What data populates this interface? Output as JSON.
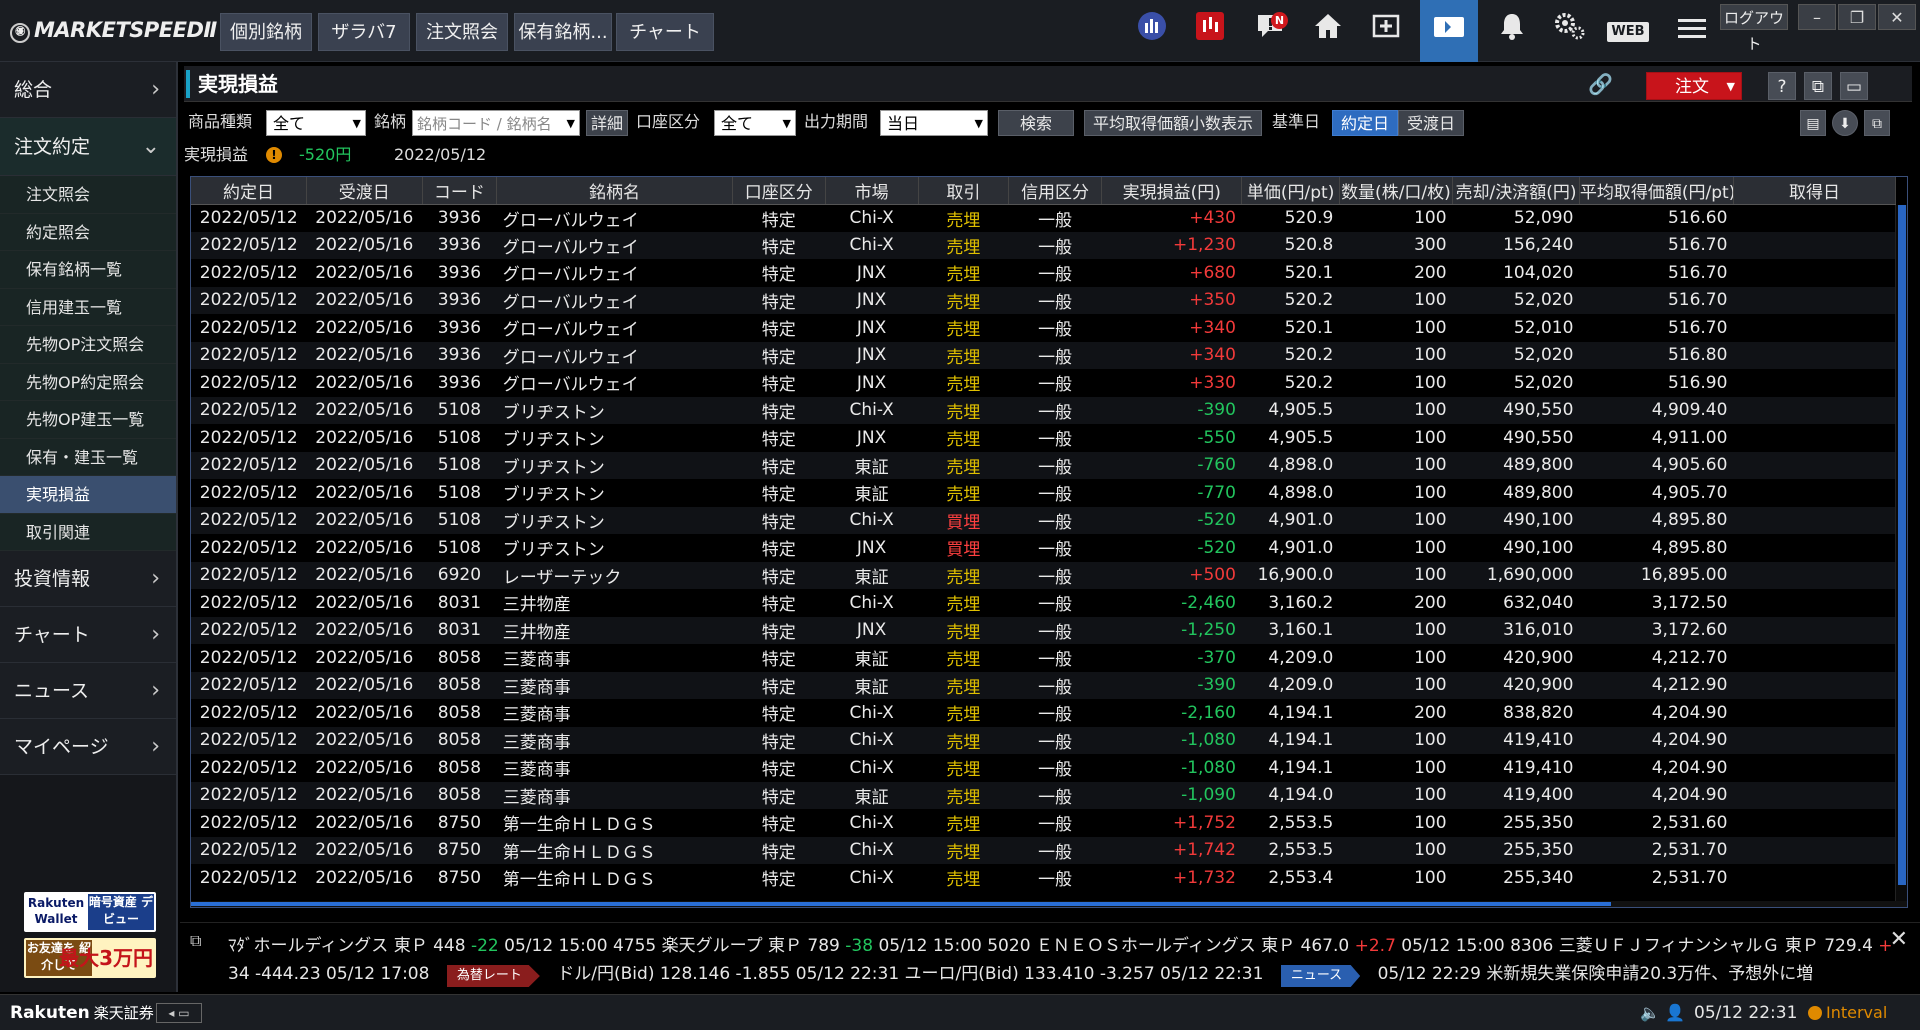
{
  "app": {
    "logo": "MARKETSPEEDⅡ",
    "top_tabs": [
      "個別銘柄",
      "ザラバ7",
      "注文照会",
      "保有銘柄...",
      "チャート"
    ],
    "notification_badge": "N",
    "web_label": "WEB",
    "logout_label": "ログアウト"
  },
  "sidebar": {
    "majors": [
      {
        "label": "総合"
      },
      {
        "label": "注文約定"
      },
      {
        "label": "投資情報"
      },
      {
        "label": "チャート"
      },
      {
        "label": "ニュース"
      },
      {
        "label": "マイページ"
      }
    ],
    "sub_items": [
      "注文照会",
      "約定照会",
      "保有銘柄一覧",
      "信用建玉一覧",
      "先物OP注文照会",
      "先物OP約定照会",
      "先物OP建玉一覧",
      "保有・建玉一覧",
      "実現損益",
      "取引関連"
    ],
    "active_sub": "実現損益",
    "promo1": {
      "left": "Rakuten Wallet",
      "right": "暗号資産 デビュー"
    },
    "promo2": {
      "left": "お友達を 紹介して",
      "right": "最大3万円"
    }
  },
  "panel": {
    "title": "実現損益",
    "order_button": "注文",
    "help_icon": "?"
  },
  "filters": {
    "product_type_label": "商品種類",
    "product_type_value": "全て",
    "symbol_label": "銘柄",
    "symbol_placeholder": "銘柄コード / 銘柄名",
    "detail_button": "詳細",
    "account_label": "口座区分",
    "account_value": "全て",
    "period_label": "出力期間",
    "period_value": "当日",
    "search_button": "検索",
    "avg_price_button": "平均取得価額小数表示",
    "base_date_label": "基準日",
    "trade_date_button": "約定日",
    "settle_date_button": "受渡日"
  },
  "summary": {
    "label": "実現損益",
    "value": "-520円",
    "date": "2022/05/12"
  },
  "table": {
    "columns": [
      "約定日",
      "受渡日",
      "コード",
      "銘柄名",
      "口座区分",
      "市場",
      "取引",
      "信用区分",
      "実現損益(円)",
      "単価(円/pt)",
      "数量(株/口/枚)",
      "売却/決済額(円)",
      "平均取得価額(円/pt)",
      "取得日"
    ],
    "rows": [
      [
        "2022/05/12",
        "2022/05/16",
        "3936",
        "グローバルウェイ",
        "特定",
        "Chi-X",
        "売埋",
        "一般",
        "+430",
        "520.9",
        "100",
        "52,090",
        "516.60"
      ],
      [
        "2022/05/12",
        "2022/05/16",
        "3936",
        "グローバルウェイ",
        "特定",
        "Chi-X",
        "売埋",
        "一般",
        "+1,230",
        "520.8",
        "300",
        "156,240",
        "516.70"
      ],
      [
        "2022/05/12",
        "2022/05/16",
        "3936",
        "グローバルウェイ",
        "特定",
        "JNX",
        "売埋",
        "一般",
        "+680",
        "520.1",
        "200",
        "104,020",
        "516.70"
      ],
      [
        "2022/05/12",
        "2022/05/16",
        "3936",
        "グローバルウェイ",
        "特定",
        "JNX",
        "売埋",
        "一般",
        "+350",
        "520.2",
        "100",
        "52,020",
        "516.70"
      ],
      [
        "2022/05/12",
        "2022/05/16",
        "3936",
        "グローバルウェイ",
        "特定",
        "JNX",
        "売埋",
        "一般",
        "+340",
        "520.1",
        "100",
        "52,010",
        "516.70"
      ],
      [
        "2022/05/12",
        "2022/05/16",
        "3936",
        "グローバルウェイ",
        "特定",
        "JNX",
        "売埋",
        "一般",
        "+340",
        "520.2",
        "100",
        "52,020",
        "516.80"
      ],
      [
        "2022/05/12",
        "2022/05/16",
        "3936",
        "グローバルウェイ",
        "特定",
        "JNX",
        "売埋",
        "一般",
        "+330",
        "520.2",
        "100",
        "52,020",
        "516.90"
      ],
      [
        "2022/05/12",
        "2022/05/16",
        "5108",
        "ブリヂストン",
        "特定",
        "Chi-X",
        "売埋",
        "一般",
        "-390",
        "4,905.5",
        "100",
        "490,550",
        "4,909.40"
      ],
      [
        "2022/05/12",
        "2022/05/16",
        "5108",
        "ブリヂストン",
        "特定",
        "JNX",
        "売埋",
        "一般",
        "-550",
        "4,905.5",
        "100",
        "490,550",
        "4,911.00"
      ],
      [
        "2022/05/12",
        "2022/05/16",
        "5108",
        "ブリヂストン",
        "特定",
        "東証",
        "売埋",
        "一般",
        "-760",
        "4,898.0",
        "100",
        "489,800",
        "4,905.60"
      ],
      [
        "2022/05/12",
        "2022/05/16",
        "5108",
        "ブリヂストン",
        "特定",
        "東証",
        "売埋",
        "一般",
        "-770",
        "4,898.0",
        "100",
        "489,800",
        "4,905.70"
      ],
      [
        "2022/05/12",
        "2022/05/16",
        "5108",
        "ブリヂストン",
        "特定",
        "Chi-X",
        "買埋",
        "一般",
        "-520",
        "4,901.0",
        "100",
        "490,100",
        "4,895.80"
      ],
      [
        "2022/05/12",
        "2022/05/16",
        "5108",
        "ブリヂストン",
        "特定",
        "JNX",
        "買埋",
        "一般",
        "-520",
        "4,901.0",
        "100",
        "490,100",
        "4,895.80"
      ],
      [
        "2022/05/12",
        "2022/05/16",
        "6920",
        "レーザーテック",
        "特定",
        "東証",
        "売埋",
        "一般",
        "+500",
        "16,900.0",
        "100",
        "1,690,000",
        "16,895.00"
      ],
      [
        "2022/05/12",
        "2022/05/16",
        "8031",
        "三井物産",
        "特定",
        "Chi-X",
        "売埋",
        "一般",
        "-2,460",
        "3,160.2",
        "200",
        "632,040",
        "3,172.50"
      ],
      [
        "2022/05/12",
        "2022/05/16",
        "8031",
        "三井物産",
        "特定",
        "JNX",
        "売埋",
        "一般",
        "-1,250",
        "3,160.1",
        "100",
        "316,010",
        "3,172.60"
      ],
      [
        "2022/05/12",
        "2022/05/16",
        "8058",
        "三菱商事",
        "特定",
        "東証",
        "売埋",
        "一般",
        "-370",
        "4,209.0",
        "100",
        "420,900",
        "4,212.70"
      ],
      [
        "2022/05/12",
        "2022/05/16",
        "8058",
        "三菱商事",
        "特定",
        "東証",
        "売埋",
        "一般",
        "-390",
        "4,209.0",
        "100",
        "420,900",
        "4,212.90"
      ],
      [
        "2022/05/12",
        "2022/05/16",
        "8058",
        "三菱商事",
        "特定",
        "Chi-X",
        "売埋",
        "一般",
        "-2,160",
        "4,194.1",
        "200",
        "838,820",
        "4,204.90"
      ],
      [
        "2022/05/12",
        "2022/05/16",
        "8058",
        "三菱商事",
        "特定",
        "Chi-X",
        "売埋",
        "一般",
        "-1,080",
        "4,194.1",
        "100",
        "419,410",
        "4,204.90"
      ],
      [
        "2022/05/12",
        "2022/05/16",
        "8058",
        "三菱商事",
        "特定",
        "Chi-X",
        "売埋",
        "一般",
        "-1,080",
        "4,194.1",
        "100",
        "419,410",
        "4,204.90"
      ],
      [
        "2022/05/12",
        "2022/05/16",
        "8058",
        "三菱商事",
        "特定",
        "東証",
        "売埋",
        "一般",
        "-1,090",
        "4,194.0",
        "100",
        "419,400",
        "4,204.90"
      ],
      [
        "2022/05/12",
        "2022/05/16",
        "8750",
        "第一生命ＨＬＤＧＳ",
        "特定",
        "Chi-X",
        "売埋",
        "一般",
        "+1,752",
        "2,553.5",
        "100",
        "255,350",
        "2,531.60"
      ],
      [
        "2022/05/12",
        "2022/05/16",
        "8750",
        "第一生命ＨＬＤＧＳ",
        "特定",
        "Chi-X",
        "売埋",
        "一般",
        "+1,742",
        "2,553.5",
        "100",
        "255,350",
        "2,531.70"
      ],
      [
        "2022/05/12",
        "2022/05/16",
        "8750",
        "第一生命ＨＬＤＧＳ",
        "特定",
        "Chi-X",
        "売埋",
        "一般",
        "+1,732",
        "2,553.4",
        "100",
        "255,340",
        "2,531.70"
      ]
    ]
  },
  "ticker": {
    "line1": [
      {
        "text": "ﾏﾀﾞホールディングス 東Ｐ 448 ",
        "cls": ""
      },
      {
        "text": "-22",
        "cls": "dn"
      },
      {
        "text": " 05/12 15:00     4755 楽天グループ 東Ｐ 789 ",
        "cls": ""
      },
      {
        "text": "-38",
        "cls": "dn"
      },
      {
        "text": " 05/12 15:00     5020 ＥＮＥＯＳホールディングス 東Ｐ 467.0 ",
        "cls": ""
      },
      {
        "text": "+2.7",
        "cls": "up"
      },
      {
        "text": " 05/12 15:00     8306 三菱ＵＦＪフィナンシャルＧ 東Ｐ 729.4 ",
        "cls": ""
      },
      {
        "text": "+",
        "cls": "up"
      }
    ],
    "line2_a": "34  -444.23  05/12  17:08",
    "fx_tag": "為替レート",
    "line2_b": "ドル/円(Bid)  128.146  -1.855  05/12 22:31      ユーロ/円(Bid)  133.410  -3.257  05/12 22:31",
    "news_tag": "ニュース",
    "line2_c": "05/12 22:29  米新規失業保険申請20.3万件、予想外に増"
  },
  "statusbar": {
    "brand": "Rakuten",
    "brand_jp": "楽天証券",
    "time": "05/12 22:31",
    "interval": "Interval"
  },
  "colors": {
    "accent": "#2e6cc0",
    "order": "#c8141b",
    "positive": "#f23a3a",
    "negative": "#22c55e",
    "sell": "#e0c000"
  }
}
